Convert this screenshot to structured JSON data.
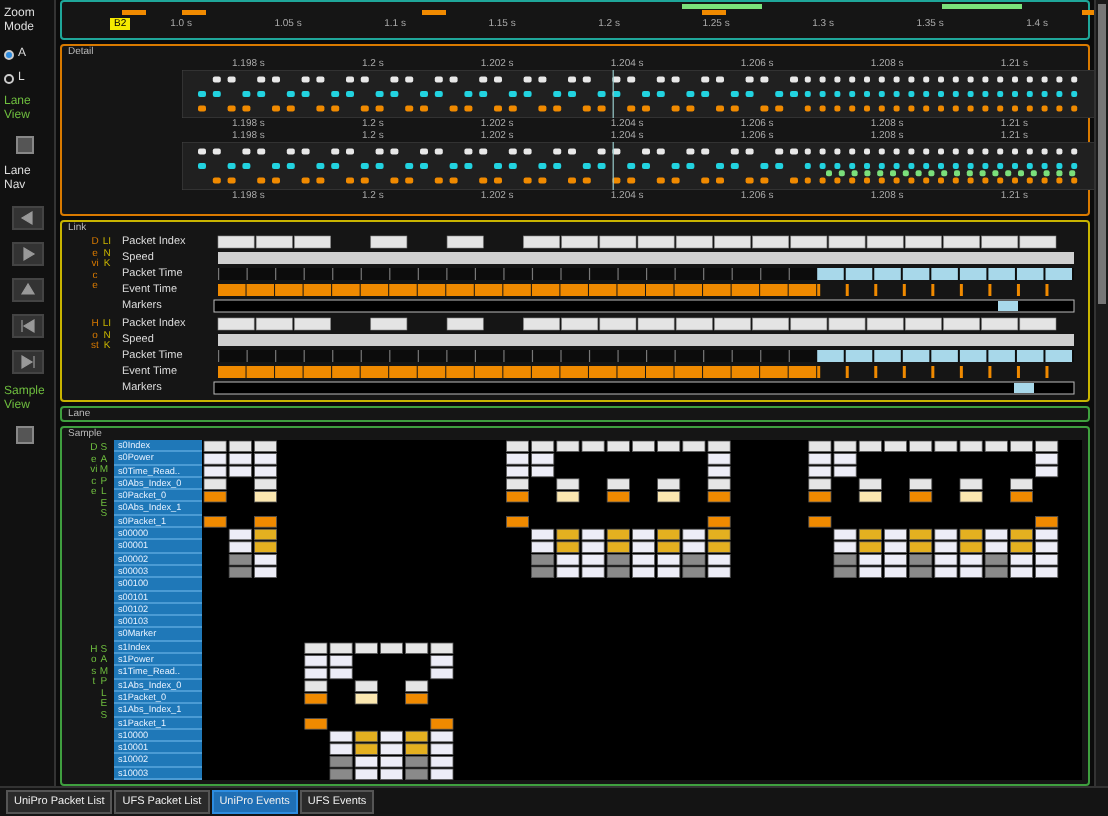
{
  "sidebar": {
    "zoom_mode": {
      "label": "Zoom Mode",
      "options": [
        {
          "label": "A",
          "selected": true
        },
        {
          "label": "L",
          "selected": false
        }
      ]
    },
    "lane_view": {
      "label": "Lane View",
      "checked": false
    },
    "lane_nav": {
      "label": "Lane Nav"
    },
    "sample_view": {
      "label": "Sample View",
      "checked": false
    }
  },
  "overview": {
    "marker": "B2",
    "ticks": [
      "1.0 s",
      "1.05 s",
      "1.1 s",
      "1.15 s",
      "1.2 s",
      "1.25 s",
      "1.3 s",
      "1.35 s",
      "1.4 s"
    ]
  },
  "detail": {
    "title": "Detail",
    "rulers": [
      [
        "1.198 s",
        "1.2 s",
        "1.202 s",
        "1.204 s",
        "1.206 s",
        "1.208 s",
        "1.21 s"
      ],
      [
        "1.198 s",
        "1.2 s",
        "1.202 s",
        "1.204 s",
        "1.206 s",
        "1.208 s",
        "1.21 s"
      ],
      [
        "1.198 s",
        "1.2 s",
        "1.202 s",
        "1.204 s",
        "1.206 s",
        "1.208 s",
        "1.21 s"
      ],
      [
        "1.198 s",
        "1.2 s",
        "1.202 s",
        "1.204 s",
        "1.206 s",
        "1.208 s",
        "1.21 s"
      ]
    ]
  },
  "link": {
    "title": "Link",
    "groups": [
      {
        "side": "Device",
        "type": "LINK",
        "rows": [
          "Packet Index",
          "Speed",
          "Packet Time",
          "Event Time",
          "Markers"
        ]
      },
      {
        "side": "Host",
        "type": "LINK",
        "rows": [
          "Packet Index",
          "Speed",
          "Packet Time",
          "Event Time",
          "Markers"
        ]
      }
    ]
  },
  "lane": {
    "title": "Lane"
  },
  "sample": {
    "title": "Sample",
    "groups": [
      {
        "side": "Device",
        "type": "SAMPLES",
        "rows": [
          "s0Index",
          "s0Power",
          "s0Time_Read..",
          "s0Abs_Index_0",
          "s0Packet_0",
          "s0Abs_Index_1",
          "s0Packet_1",
          "s00000",
          "s00001",
          "s00002",
          "s00003",
          "s00100",
          "s00101",
          "s00102",
          "s00103",
          "s0Marker"
        ]
      },
      {
        "side": "Host",
        "type": "SAMPLES",
        "rows": [
          "s1Index",
          "s1Power",
          "s1Time_Read..",
          "s1Abs_Index_0",
          "s1Packet_0",
          "s1Abs_Index_1",
          "s1Packet_1",
          "s10000",
          "s10001",
          "s10002",
          "s10003"
        ]
      }
    ]
  },
  "tabs": [
    {
      "label": "UniPro Packet List",
      "selected": false
    },
    {
      "label": "UFS Packet List",
      "selected": false
    },
    {
      "label": "UniPro Events",
      "selected": true
    },
    {
      "label": "UFS Events",
      "selected": false
    }
  ]
}
